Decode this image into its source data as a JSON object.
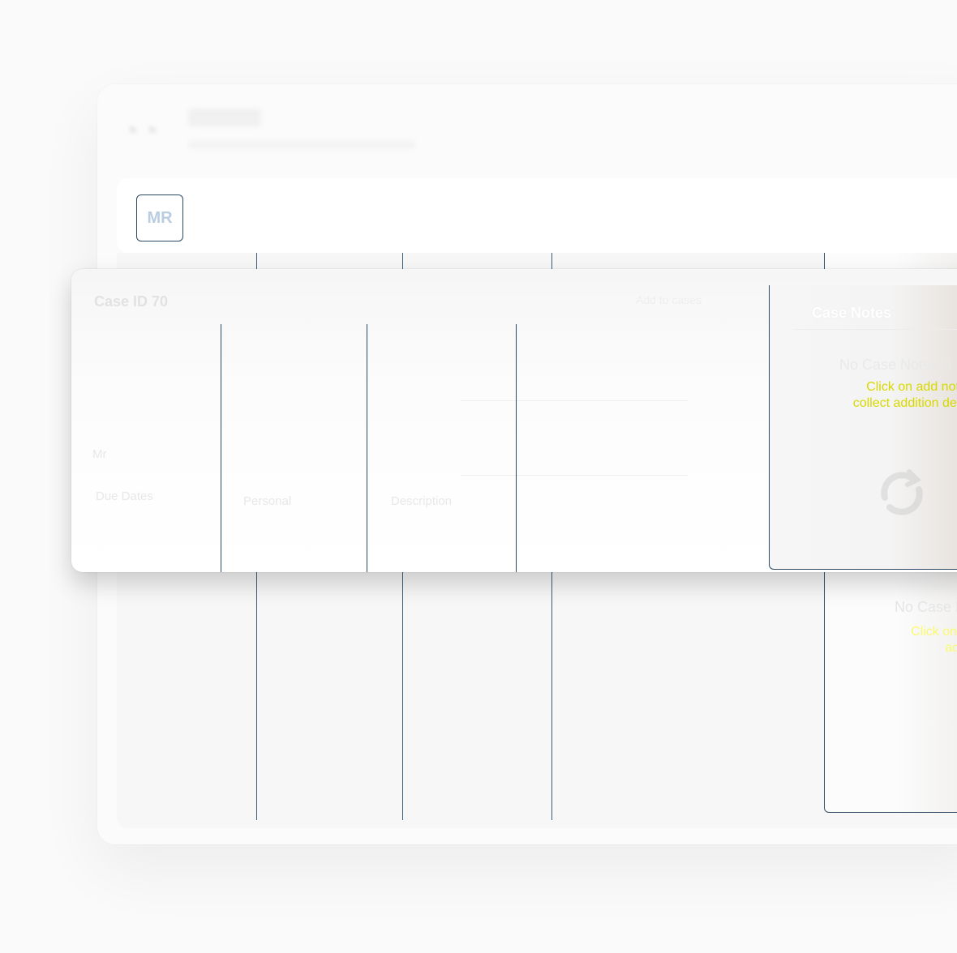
{
  "background_window": {
    "avatar_initials": "MR",
    "notes_empty_title": "No Case No",
    "notes_hint": "Click on add collect ad deta"
  },
  "modal": {
    "case_id": "Case ID 70",
    "meta_text": "Add to cases",
    "field_labels": [
      "Mr",
      "Personal",
      "Description",
      "Due Dates",
      "Due Dates"
    ],
    "notes": {
      "title": "Case Notes",
      "empty_title": "No Case Notes A",
      "hint": "Click on add note collect addition details",
      "icon": "refresh-icon"
    }
  },
  "colors": {
    "accent_line": "#2a4a6a",
    "hint_text": "#d8d800",
    "avatar_text": "#b8cde0"
  }
}
